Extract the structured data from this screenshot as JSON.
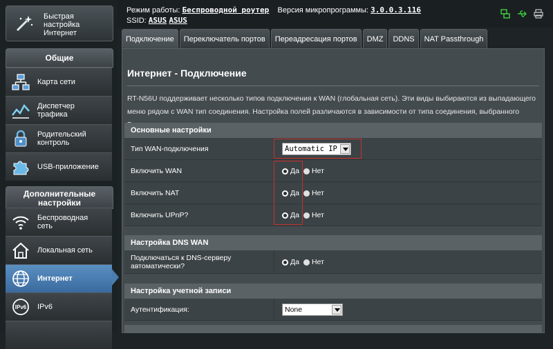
{
  "colors": {
    "accent": "#4a7db0",
    "highlight": "#c8302c",
    "active_item": "#3a6a9e"
  },
  "sidebar": {
    "quick_setup": {
      "label": "Быстрая настройка Интернет",
      "icon": "magic-wand-icon"
    },
    "section_general": "Общие",
    "general_items": [
      {
        "label": "Карта сети",
        "icon": "network-map-icon"
      },
      {
        "label": "Диспетчер трафика",
        "icon": "traffic-manager-icon"
      },
      {
        "label": "Родительский контроль",
        "icon": "lock-icon"
      },
      {
        "label": "USB-приложение",
        "icon": "puzzle-icon"
      }
    ],
    "section_advanced": "Дополнительные настройки",
    "advanced_items": [
      {
        "label": "Беспроводная сеть",
        "icon": "wifi-icon"
      },
      {
        "label": "Локальная сеть",
        "icon": "home-icon"
      },
      {
        "label": "Интернет",
        "icon": "globe-icon",
        "active": true
      },
      {
        "label": "IPv6",
        "icon": "ipv6-icon"
      }
    ]
  },
  "topbar": {
    "mode_label": "Режим работы:",
    "mode_value": "Беспроводной роутер",
    "fw_label": "Версия микропрограммы:",
    "fw_value": "3.0.0.3.116",
    "ssid_label": "SSID:",
    "ssid_1": "ASUS",
    "ssid_2": "ASUS",
    "icons": [
      "network-status-icon",
      "usb-icon",
      "printer-icon"
    ]
  },
  "tabs": [
    "Подключение",
    "Переключатель портов",
    "Переадресация портов",
    "DMZ",
    "DDNS",
    "NAT Passthrough"
  ],
  "main": {
    "title": "Интернет - Подключение",
    "description": "RT-N56U поддерживает несколько типов подключения к WAN (глобальная сеть). Эти виды выбираются из выпадающего меню рядом с WAN тип соединения. Настройка полей различаются в зависимости от типа соединения, выбранного Вами.",
    "basic": {
      "header": "Основные настройки",
      "wan_type_label": "Тип WAN-подключения",
      "wan_type_value": "Automatic IP",
      "enable_wan_label": "Включить WAN",
      "enable_nat_label": "Включить NAT",
      "enable_upnp_label": "Включить UPnP?",
      "yes": "Да",
      "no": "Нет"
    },
    "dns": {
      "header": "Настройка DNS WAN",
      "auto_dns_label": "Подключаться к DNS-серверу автоматически?",
      "yes": "Да",
      "no": "Нет"
    },
    "account": {
      "header": "Настройка учетной записи",
      "auth_label": "Аутентификация:",
      "auth_value": "None"
    }
  }
}
